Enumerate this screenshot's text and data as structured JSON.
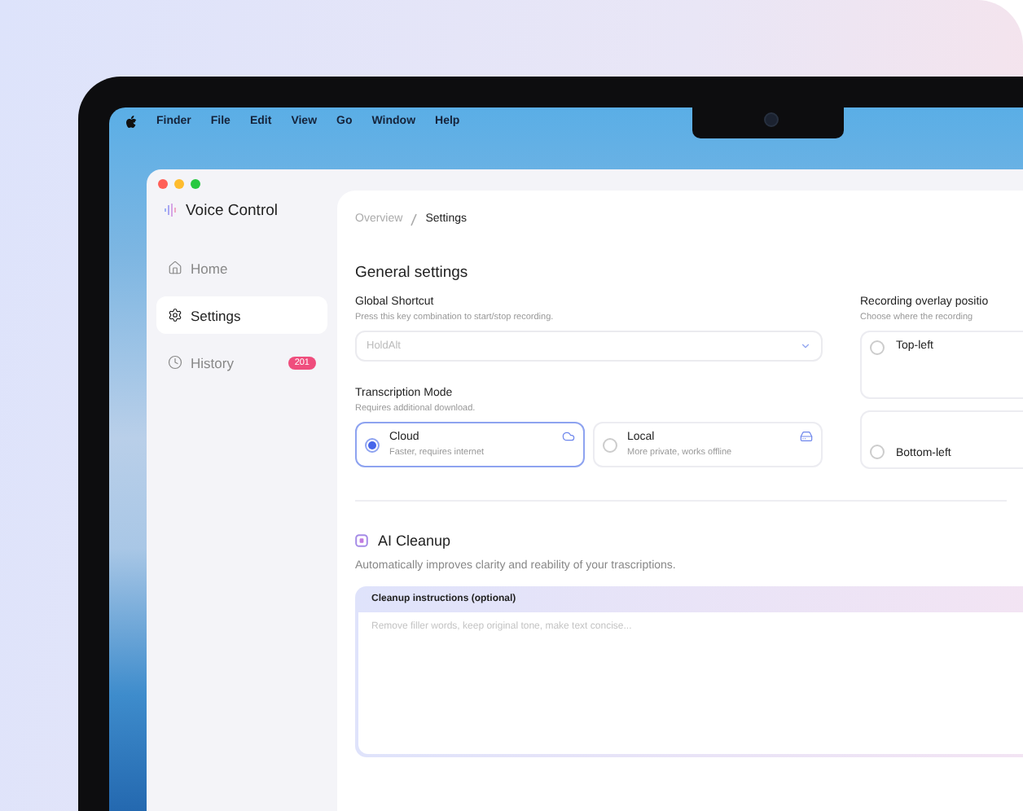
{
  "menu_bar": {
    "items": [
      "Finder",
      "File",
      "Edit",
      "View",
      "Go",
      "Window",
      "Help"
    ]
  },
  "app": {
    "name": "Voice Control"
  },
  "sidebar": {
    "items": [
      {
        "label": "Home",
        "kind": "home",
        "selected": false
      },
      {
        "label": "Settings",
        "kind": "gear",
        "selected": true
      },
      {
        "label": "History",
        "kind": "clock",
        "selected": false,
        "badge": "201"
      }
    ]
  },
  "breadcrumb": [
    "Overview",
    "Settings"
  ],
  "general": {
    "title": "General settings",
    "shortcut": {
      "label": "Global Shortcut",
      "hint": "Press this key combination to start/stop recording.",
      "placeholder": "HoldAlt"
    },
    "mode": {
      "label": "Transcription Mode",
      "hint": "Requires additional download.",
      "options": [
        {
          "title": "Cloud",
          "subtitle": "Faster, requires internet",
          "kind": "cloud",
          "selected": true
        },
        {
          "title": "Local",
          "subtitle": "More private, works offline",
          "kind": "drive",
          "selected": false
        }
      ]
    },
    "overlay": {
      "label": "Recording overlay positio",
      "hint": "Choose where the recording",
      "options": [
        {
          "title": "Top-left",
          "selected": false
        },
        {
          "title": "Bottom-left",
          "selected": false
        }
      ]
    }
  },
  "ai_cleanup": {
    "title": "AI Cleanup",
    "description": "Automatically improves clarity and reability of your trascriptions.",
    "field_label": "Cleanup instructions (optional)",
    "placeholder": "Remove filler words, keep original tone, make text concise..."
  }
}
